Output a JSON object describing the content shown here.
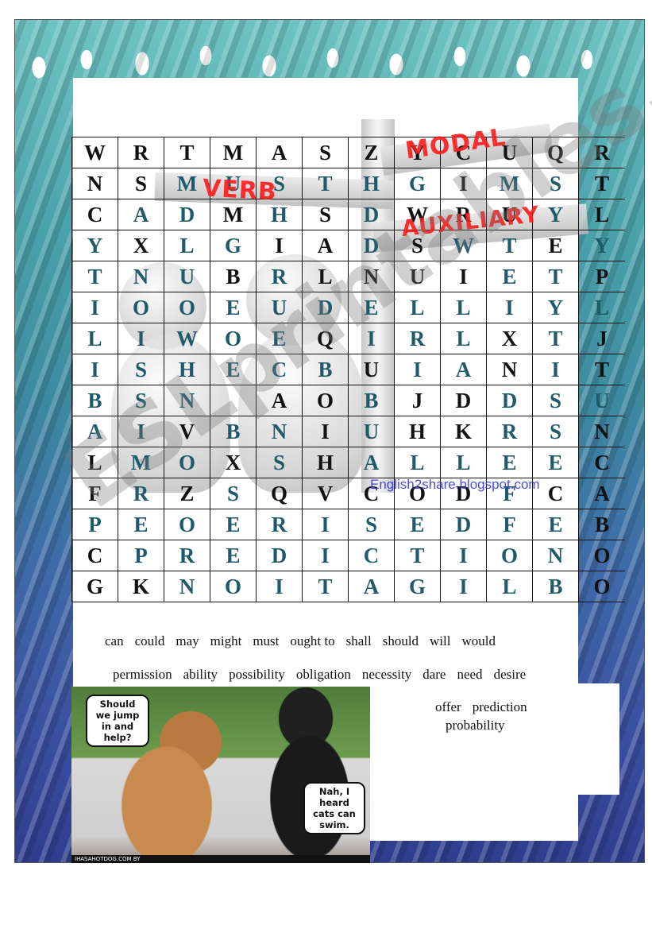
{
  "worksheet": {
    "sign_labels": {
      "verb": "VERB",
      "modal": "MODAL",
      "auxiliary": "AUXILIARY"
    },
    "blog_credit": "English2share.blogspot.com",
    "watermark": "ESLprintables.com",
    "colors": {
      "hidden_letter": "#1f5a6a",
      "filler_letter": "#111111",
      "sign_text": "#ff1a1a",
      "credit_text": "#2b2be6"
    },
    "grid": {
      "rows": [
        [
          "W",
          "R",
          "T",
          "M",
          "A",
          "S",
          "Z",
          "Y",
          "C",
          "U",
          "Q",
          "R"
        ],
        [
          "N",
          "S",
          "M",
          "U",
          "S",
          "T",
          "H",
          "G",
          "I",
          "M",
          "S",
          "T"
        ],
        [
          "C",
          "A",
          "D",
          "M",
          "H",
          "S",
          "D",
          "W",
          "R",
          "U",
          "Y",
          "L"
        ],
        [
          "Y",
          "X",
          "L",
          "G",
          "I",
          "A",
          "D",
          "S",
          "W",
          "T",
          "E",
          "Y"
        ],
        [
          "T",
          "N",
          "U",
          "B",
          "R",
          "L",
          "N",
          "U",
          "I",
          "E",
          "T",
          "P"
        ],
        [
          "I",
          "O",
          "O",
          "E",
          "U",
          "D",
          "E",
          "L",
          "L",
          "I",
          "Y",
          "L"
        ],
        [
          "L",
          "I",
          "W",
          "O",
          "E",
          "Q",
          "I",
          "R",
          "L",
          "X",
          "T",
          "J"
        ],
        [
          "I",
          "S",
          "H",
          "E",
          "C",
          "B",
          "U",
          "I",
          "A",
          "N",
          "I",
          "T"
        ],
        [
          "B",
          "S",
          "N",
          "",
          "A",
          "O",
          "B",
          "J",
          "D",
          "D",
          "S",
          "U"
        ],
        [
          "A",
          "I",
          "V",
          "B",
          "N",
          "I",
          "U",
          "H",
          "K",
          "R",
          "S",
          "N"
        ],
        [
          "L",
          "M",
          "O",
          "X",
          "S",
          "H",
          "A",
          "L",
          "L",
          "E",
          "E",
          "C"
        ],
        [
          "F",
          "R",
          "Z",
          "S",
          "Q",
          "V",
          "C",
          "O",
          "D",
          "F",
          "C",
          "A"
        ],
        [
          "P",
          "E",
          "O",
          "E",
          "R",
          "I",
          "S",
          "E",
          "D",
          "F",
          "E",
          "B"
        ],
        [
          "C",
          "P",
          "R",
          "E",
          "D",
          "I",
          "C",
          "T",
          "I",
          "O",
          "N",
          "O"
        ],
        [
          "G",
          "K",
          "N",
          "O",
          "I",
          "T",
          "A",
          "G",
          "I",
          "L",
          "B",
          "O"
        ]
      ],
      "highlighted": [
        "000000000000",
        "001111110110",
        "011010100010",
        "101100101101",
        "111010000110",
        "111111111111",
        "111110111010",
        "111111011010",
        "111000100111",
        "110110100110",
        "011010111110",
        "010100000100",
        "111111111110",
        "011111111110",
        "001111111110"
      ]
    },
    "word_list": {
      "line1": [
        "can",
        "could",
        "may",
        "might",
        "must",
        "ought to",
        "shall",
        "should",
        "will",
        "would"
      ],
      "line2": [
        "permission",
        "ability",
        "possibility",
        "obligation",
        "necessity",
        "dare",
        "need",
        "desire"
      ],
      "line3": [
        "offer",
        "prediction"
      ],
      "line4": [
        "probability"
      ]
    },
    "photo": {
      "bubble_left": "Should\nwe jump\nin and\nhelp?",
      "bubble_right": "Nah, I\nheard\ncats can\nswim.",
      "credit": "IHASAHOTDOG.COM BY"
    }
  }
}
